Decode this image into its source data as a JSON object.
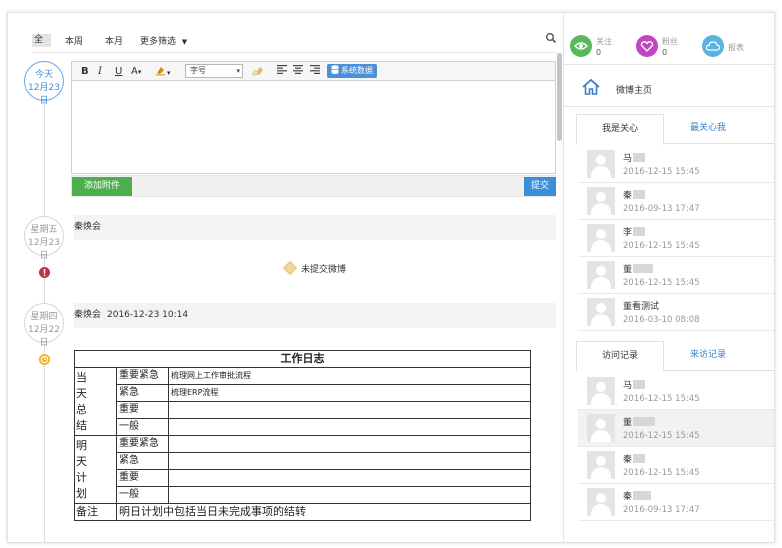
{
  "filters": {
    "active": "全部",
    "week": "本周",
    "month": "本月",
    "more": "更多筛选",
    "more_caret": "▼"
  },
  "editor": {
    "toolbar": {
      "bold": "B",
      "italic": "I",
      "underline": "U",
      "font_color": "A",
      "dropdown_caret": "▾",
      "font_size": "字号",
      "system_data": "系统数据"
    },
    "attach_label": "添加附件",
    "submit_label": "提交"
  },
  "timeline": {
    "today": {
      "weekday": "今天",
      "date": "12月23日"
    },
    "friday": {
      "weekday": "星期五",
      "date": "12月23日"
    },
    "thursday": {
      "weekday": "星期四",
      "date": "12月22日"
    }
  },
  "entries": {
    "friday": {
      "name": "秦焕会"
    },
    "not_submitted": "未提交微博",
    "thursday": {
      "name": "秦焕会",
      "time": "2016-12-23 10:14"
    }
  },
  "worklog": {
    "title": "工作日志",
    "today_label": "当\n天\n总\n结",
    "tomorrow_label": "明\n天\n计\n划",
    "rows_today": [
      {
        "cat": "重要紧急",
        "val": "梳理网上工作审批流程"
      },
      {
        "cat": "紧急",
        "val": "梳理ERP流程"
      },
      {
        "cat": "重要",
        "val": ""
      },
      {
        "cat": "一般",
        "val": ""
      }
    ],
    "rows_tomorrow": [
      {
        "cat": "重要紧急",
        "val": ""
      },
      {
        "cat": "紧急",
        "val": ""
      },
      {
        "cat": "重要",
        "val": ""
      },
      {
        "cat": "一般",
        "val": ""
      }
    ],
    "remark_label": "备注",
    "remark_value": "明日计划中包括当日未完成事项的结转"
  },
  "stats": {
    "follow": {
      "label": "关注",
      "count": "0"
    },
    "fans": {
      "label": "粉丝",
      "count": "0"
    },
    "report": {
      "label": "报表"
    }
  },
  "home": {
    "label": "微博主页"
  },
  "tabs_care": {
    "active": "我是关心",
    "inactive": "最关心我"
  },
  "care_list": [
    {
      "name": "马",
      "date": "2016-12-15 15:45"
    },
    {
      "name": "秦",
      "date": "2016-09-13 17:47"
    },
    {
      "name": "李",
      "date": "2016-12-15 15:45"
    },
    {
      "name": "董",
      "date": "2016-12-15 15:45"
    },
    {
      "name": "董看测试",
      "date": "2016-03-10 08:08"
    }
  ],
  "tabs_visit": {
    "active": "访问记录",
    "inactive": "来访记录"
  },
  "visit_list": [
    {
      "name": "马",
      "date": "2016-12-15 15:45"
    },
    {
      "name": "董",
      "date": "2016-12-15 15:45"
    },
    {
      "name": "秦",
      "date": "2016-12-15 15:45"
    },
    {
      "name": "秦",
      "date": "2016-09-13 17:47"
    }
  ],
  "colors": {
    "accent_blue": "#3b8fd9",
    "attach_green": "#4cae4c",
    "follow_green": "#5cb85c",
    "fans_purple": "#c246c2",
    "report_blue": "#5bb3e0",
    "warn_red": "#c0314c",
    "clock_orange": "#f0b129"
  }
}
